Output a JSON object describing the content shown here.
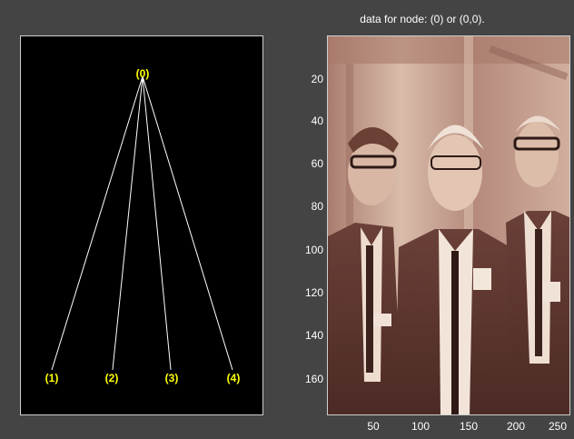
{
  "tree": {
    "root": {
      "label": "(0)"
    },
    "children": [
      {
        "label": "(1)"
      },
      {
        "label": "(2)"
      },
      {
        "label": "(3)"
      },
      {
        "label": "(4)"
      }
    ]
  },
  "image_panel": {
    "title": "data for node: (0) or (0,0).",
    "y_ticks": [
      "20",
      "40",
      "60",
      "80",
      "100",
      "120",
      "140",
      "160"
    ],
    "x_ticks": [
      "50",
      "100",
      "150",
      "200",
      "250"
    ]
  },
  "colors": {
    "background": "#444444",
    "tree_background": "#000000",
    "node_label": "#ffff00",
    "edges": "#ffffff",
    "image_tint": "#c8a596"
  }
}
